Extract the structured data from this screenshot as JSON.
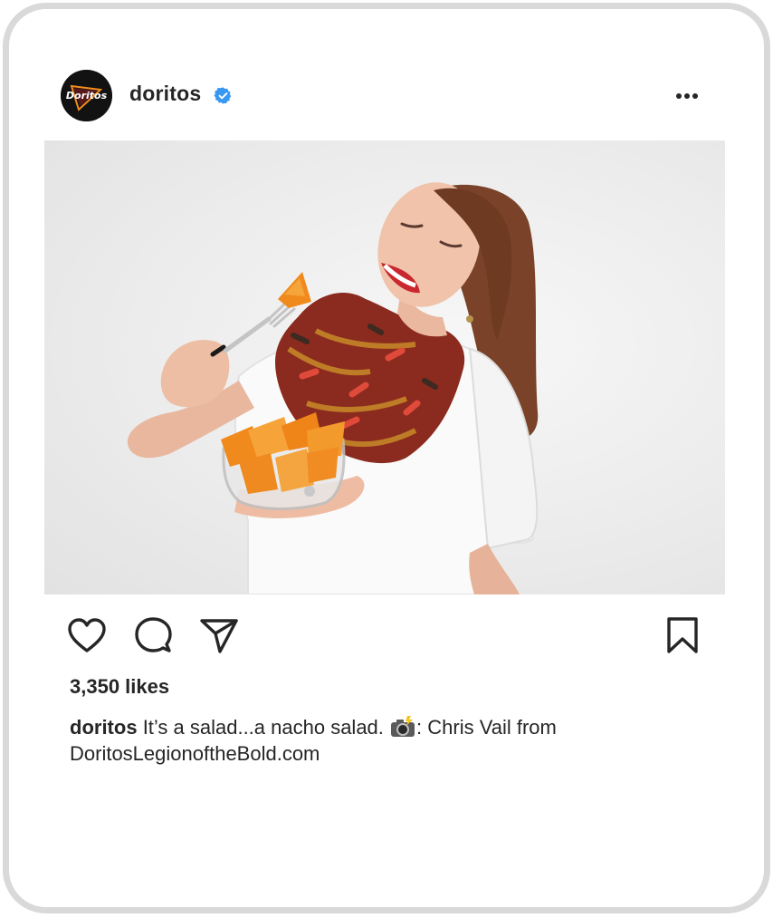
{
  "post": {
    "username": "doritos",
    "avatar_text": "Doritos",
    "likes": "3,350 likes",
    "caption_user": "doritos",
    "caption_text_1": "It’s a salad...a nacho salad.",
    "caption_text_2": ": Chris Vail from",
    "caption_text_3": "DoritosLegionoftheBold.com"
  },
  "icons": {
    "verified": "verified-badge-icon",
    "more": "more-options-icon",
    "like": "heart-icon",
    "comment": "comment-icon",
    "share": "paper-plane-icon",
    "save": "bookmark-icon",
    "camera": "camera-flash-emoji"
  },
  "colors": {
    "verified_blue": "#3897f0",
    "text": "#262626",
    "frame": "#d9d9d9",
    "avatar_bg": "#121212",
    "logo_orange": "#f28c1e"
  }
}
